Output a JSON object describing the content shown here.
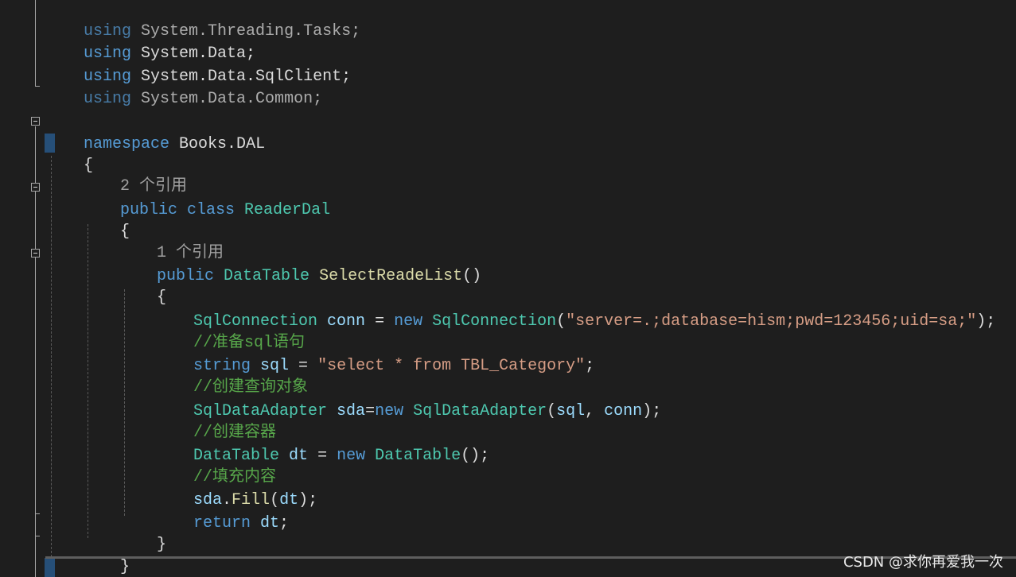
{
  "editor": {
    "lines": {
      "l01": {
        "kw": "using",
        "rest": " System.Threading.Tasks;"
      },
      "l02": {
        "kw": "using",
        "rest": " System.Data;"
      },
      "l03": {
        "kw": "using",
        "rest": " System.Data.SqlClient;"
      },
      "l04": {
        "kw": "using",
        "rest": " System.Data.Common;"
      },
      "l06": {
        "kw": "namespace",
        "rest": " Books.DAL"
      },
      "l07": {
        "brace": "{"
      },
      "l08": {
        "codelens": "2 个引用"
      },
      "l09": {
        "kw1": "public",
        "kw2": " class",
        "type": " ReaderDal"
      },
      "l10": {
        "brace": "{"
      },
      "l11": {
        "codelens": "1 个引用"
      },
      "l12": {
        "kw": "public",
        "type": " DataTable",
        "fn": " SelectReadeList",
        "punc": "()"
      },
      "l13": {
        "brace": "{"
      },
      "l14": {
        "type": "SqlConnection",
        "id": " conn",
        "op": " = ",
        "kw": "new",
        "type2": " SqlConnection",
        "open": "(",
        "str": "\"server=.;database=hism;pwd=123456;uid=sa;\"",
        "close": ");"
      },
      "l15": {
        "comment": "//准备sql语句"
      },
      "l16": {
        "kw": "string",
        "id": " sql",
        "op": " = ",
        "str": "\"select * from TBL_Category\"",
        "close": ";"
      },
      "l17": {
        "comment": "//创建查询对象"
      },
      "l18": {
        "type": "SqlDataAdapter",
        "id": " sda",
        "op": "=",
        "kw": "new",
        "type2": " SqlDataAdapter",
        "open": "(",
        "arg1": "sql",
        "comma": ", ",
        "arg2": "conn",
        "close": ");"
      },
      "l19": {
        "comment": "//创建容器"
      },
      "l20": {
        "type": "DataTable",
        "id": " dt",
        "op": " = ",
        "kw": "new",
        "type2": " DataTable",
        "close": "();"
      },
      "l21": {
        "comment": "//填充内容"
      },
      "l22": {
        "id": "sda",
        "dot": ".",
        "fn": "Fill",
        "open": "(",
        "arg": "dt",
        "close": ");"
      },
      "l23": {
        "kw": "return",
        "id": " dt",
        "close": ";"
      },
      "l24": {
        "brace": "}"
      },
      "l25": {
        "brace": "}"
      },
      "l26": {
        "brace": "}"
      }
    }
  },
  "watermark": "CSDN @求你再爱我一次",
  "colors": {
    "background": "#1e1e1e",
    "keyword": "#569cd6",
    "type": "#4ec9b0",
    "identifier": "#9cdcfe",
    "method": "#dcdcaa",
    "string": "#d69d85",
    "comment": "#57a64a",
    "codelens": "#a0a0a0"
  }
}
